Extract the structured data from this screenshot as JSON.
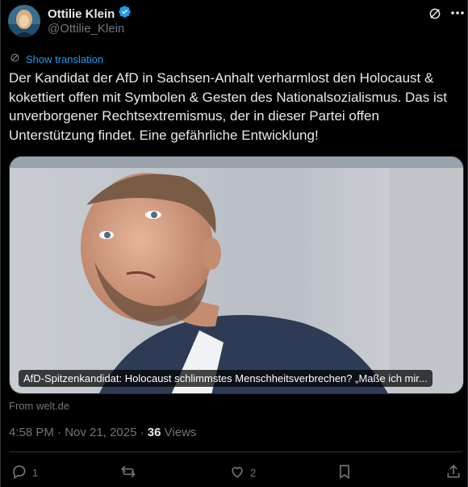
{
  "author": {
    "name": "Ottilie Klein",
    "handle": "@Ottilie_Klein",
    "verified_color": "#1d9bf0"
  },
  "translate_label": "Show translation",
  "post_text": "Der Kandidat der AfD in Sachsen-Anhalt verharmlost den Holocaust & kokettiert offen mit Symbolen & Gesten des Nationalsozialismus. Das ist unverborgener Rechtsextremismus, der in dieser Partei offen Unterstützung findet. Eine gefährliche Entwicklung!",
  "link_card": {
    "caption": "AfD-Spitzenkandidat: Holocaust schlimmstes Menschheitsverbrechen? „Maße ich mir...",
    "source": "From welt.de"
  },
  "meta": {
    "time": "4:58 PM",
    "separator": "·",
    "date": "Nov 21, 2025",
    "views_count": "36",
    "views_label": "Views"
  },
  "actions": {
    "replies": "1",
    "reposts": "",
    "likes": "2"
  },
  "icons": {
    "grok": "grok-icon",
    "more": "more-icon",
    "translate": "translate-icon",
    "reply": "reply-icon",
    "repost": "repost-icon",
    "like": "like-icon",
    "bookmark": "bookmark-icon",
    "share": "share-icon"
  },
  "colors": {
    "background": "#000000",
    "text": "#e7e9ea",
    "muted": "#71767b",
    "accent": "#1d9bf0"
  }
}
